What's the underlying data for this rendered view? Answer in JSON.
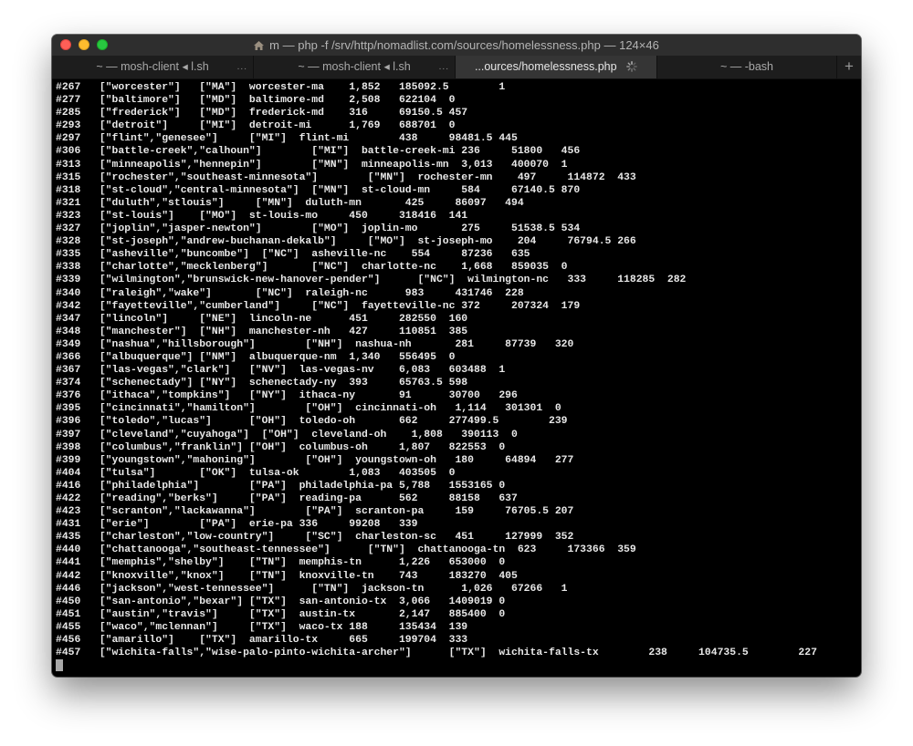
{
  "window": {
    "title": "m — php -f /srv/http/nomadlist.com/sources/homelessness.php — 124×46"
  },
  "tabs": [
    {
      "label": "~ — mosh-client ◂ l.sh",
      "more": "..."
    },
    {
      "label": "~ — mosh-client ◂ l.sh",
      "more": "..."
    },
    {
      "label": "...ources/homelessness.php",
      "more": ""
    },
    {
      "label": "~ — -bash",
      "more": ""
    }
  ],
  "new_tab_label": "+",
  "terminal": {
    "lines": [
      "#267   [\"worcester\"]   [\"MA\"]  worcester-ma    1,852   185092.5        1",
      "#277   [\"baltimore\"]   [\"MD\"]  baltimore-md    2,508   622104  0",
      "#285   [\"frederick\"]   [\"MD\"]  frederick-md    316     69150.5 457",
      "#293   [\"detroit\"]     [\"MI\"]  detroit-mi      1,769   688701  0",
      "#297   [\"flint\",\"genesee\"]     [\"MI\"]  flint-mi        438     98481.5 445",
      "#306   [\"battle-creek\",\"calhoun\"]        [\"MI\"]  battle-creek-mi 236     51800   456",
      "#313   [\"minneapolis\",\"hennepin\"]        [\"MN\"]  minneapolis-mn  3,013   400070  1",
      "#315   [\"rochester\",\"southeast-minnesota\"]        [\"MN\"]  rochester-mn    497     114872  433",
      "#318   [\"st-cloud\",\"central-minnesota\"]  [\"MN\"]  st-cloud-mn     584     67140.5 870",
      "#321   [\"duluth\",\"stlouis\"]     [\"MN\"]  duluth-mn       425     86097   494",
      "#323   [\"st-louis\"]    [\"MO\"]  st-louis-mo     450     318416  141",
      "#327   [\"joplin\",\"jasper-newton\"]        [\"MO\"]  joplin-mo       275     51538.5 534",
      "#328   [\"st-joseph\",\"andrew-buchanan-dekalb\"]     [\"MO\"]  st-joseph-mo    204     76794.5 266",
      "#335   [\"asheville\",\"buncombe\"]  [\"NC\"]  asheville-nc    554     87236   635",
      "#338   [\"charlotte\",\"mecklenberg\"]       [\"NC\"]  charlotte-nc    1,668   859035  0",
      "#339   [\"wilmington\",\"brunswick-new-hanover-pender\"]      [\"NC\"]  wilmington-nc   333     118285  282",
      "#340   [\"raleigh\",\"wake\"]       [\"NC\"]  raleigh-nc      983     431746  228",
      "#342   [\"fayetteville\",\"cumberland\"]     [\"NC\"]  fayetteville-nc 372     207324  179",
      "#347   [\"lincoln\"]     [\"NE\"]  lincoln-ne      451     282550  160",
      "#348   [\"manchester\"]  [\"NH\"]  manchester-nh   427     110851  385",
      "#349   [\"nashua\",\"hillsborough\"]        [\"NH\"]  nashua-nh       281     87739   320",
      "#366   [\"albuquerque\"] [\"NM\"]  albuquerque-nm  1,340   556495  0",
      "#367   [\"las-vegas\",\"clark\"]   [\"NV\"]  las-vegas-nv    6,083   603488  1",
      "#374   [\"schenectady\"] [\"NY\"]  schenectady-ny  393     65763.5 598",
      "#376   [\"ithaca\",\"tompkins\"]   [\"NY\"]  ithaca-ny       91      30700   296",
      "#395   [\"cincinnati\",\"hamilton\"]        [\"OH\"]  cincinnati-oh   1,114   301301  0",
      "#396   [\"toledo\",\"lucas\"]      [\"OH\"]  toledo-oh       662     277499.5        239",
      "#397   [\"cleveland\",\"cuyahoga\"]  [\"OH\"]  cleveland-oh    1,808   390113  0",
      "#398   [\"columbus\",\"franklin\"] [\"OH\"]  columbus-oh     1,807   822553  0",
      "#399   [\"youngstown\",\"mahoning\"]        [\"OH\"]  youngstown-oh   180     64894   277",
      "#404   [\"tulsa\"]       [\"OK\"]  tulsa-ok        1,083   403505  0",
      "#416   [\"philadelphia\"]        [\"PA\"]  philadelphia-pa 5,788   1553165 0",
      "#422   [\"reading\",\"berks\"]     [\"PA\"]  reading-pa      562     88158   637",
      "#423   [\"scranton\",\"lackawanna\"]        [\"PA\"]  scranton-pa     159     76705.5 207",
      "#431   [\"erie\"]        [\"PA\"]  erie-pa 336     99208   339",
      "#435   [\"charleston\",\"low-country\"]     [\"SC\"]  charleston-sc   451     127999  352",
      "#440   [\"chattanooga\",\"southeast-tennessee\"]      [\"TN\"]  chattanooga-tn  623     173366  359",
      "#441   [\"memphis\",\"shelby\"]    [\"TN\"]  memphis-tn      1,226   653000  0",
      "#442   [\"knoxville\",\"knox\"]    [\"TN\"]  knoxville-tn    743     183270  405",
      "#446   [\"jackson\",\"west-tennessee\"]      [\"TN\"]  jackson-tn      1,026   67266   1",
      "#450   [\"san-antonio\",\"bexar\"] [\"TX\"]  san-antonio-tx  3,066   1409019 0",
      "#451   [\"austin\",\"travis\"]     [\"TX\"]  austin-tx       2,147   885400  0",
      "#455   [\"waco\",\"mclennan\"]     [\"TX\"]  waco-tx 188     135434  139",
      "#456   [\"amarillo\"]    [\"TX\"]  amarillo-tx     665     199704  333",
      "#457   [\"wichita-falls\",\"wise-palo-pinto-wichita-archer\"]      [\"TX\"]  wichita-falls-tx        238     104735.5        227"
    ]
  }
}
